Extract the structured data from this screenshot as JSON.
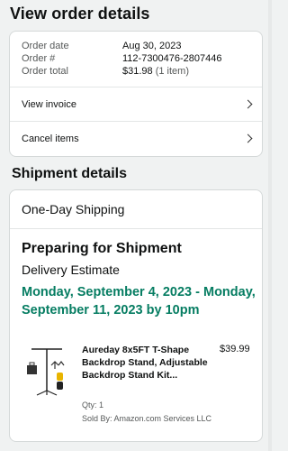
{
  "page": {
    "title": "View order details"
  },
  "order": {
    "date_label": "Order date",
    "date_value": "Aug 30, 2023",
    "number_label": "Order #",
    "number_value": "112-7300476-2807446",
    "total_label": "Order total",
    "total_value": "$31.98",
    "total_items": "(1 item)",
    "view_invoice": "View invoice",
    "cancel_items": "Cancel items"
  },
  "shipment": {
    "title": "Shipment details",
    "method": "One-Day Shipping",
    "status": "Preparing for Shipment",
    "estimate_label": "Delivery Estimate",
    "estimate_value": "Monday, September 4, 2023 - Monday, September 11, 2023 by 10pm",
    "colors": {
      "estimate": "#067d62"
    },
    "item": {
      "title": "Aureday 8x5FT T-Shape Backdrop Stand, Adjustable Backdrop Stand Kit...",
      "price": "$39.99",
      "qty": "Qty: 1",
      "sold_by": "Sold By: Amazon.com Services LLC",
      "image_icon": "backdrop-stand-product-image"
    }
  }
}
